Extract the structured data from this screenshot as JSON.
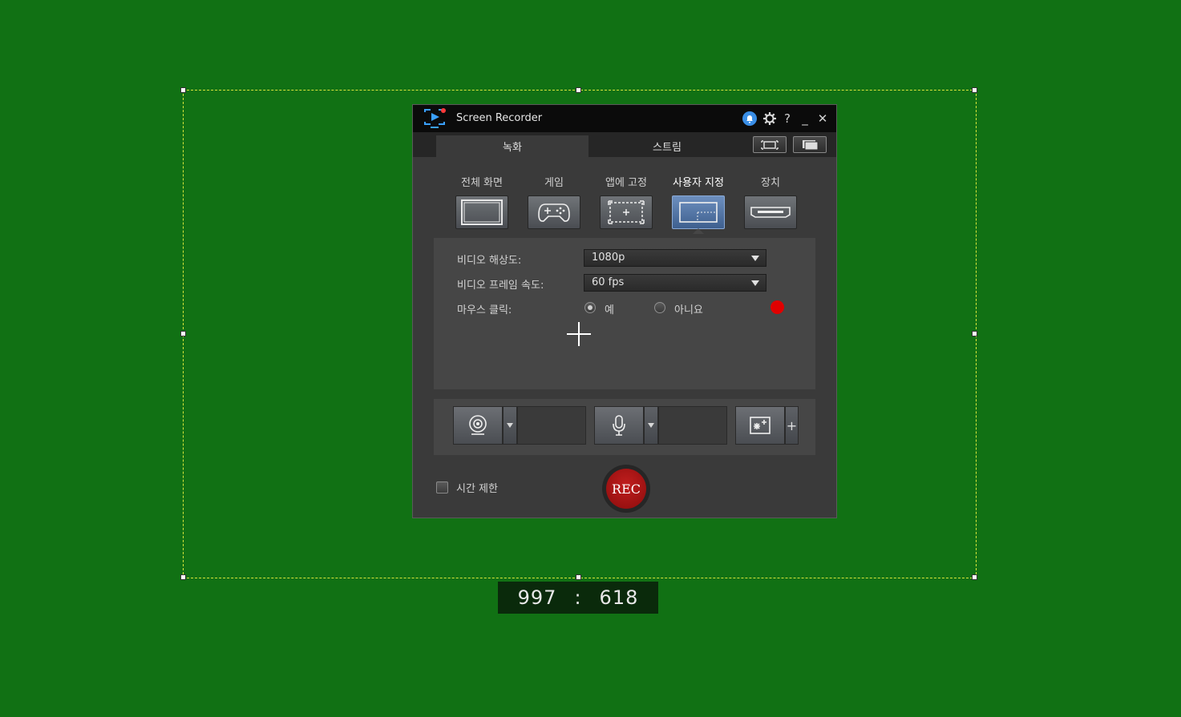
{
  "selection": {
    "width_readout": "997",
    "separator": ":",
    "height_readout": "618",
    "border_color": "#d8e63a"
  },
  "window": {
    "title": "Screen Recorder",
    "titlebar_buttons": [
      "notification-icon",
      "settings-icon",
      "help-icon",
      "minimize-icon",
      "close-icon"
    ],
    "help_glyph": "?",
    "minimize_glyph": "_",
    "close_glyph": "✕"
  },
  "tabs": [
    {
      "label": "녹화",
      "active": true
    },
    {
      "label": "스트림",
      "active": false
    }
  ],
  "modes": [
    {
      "label": "전체 화면",
      "icon": "fullscreen-icon",
      "active": false
    },
    {
      "label": "게임",
      "icon": "gamepad-icon",
      "active": false
    },
    {
      "label": "앱에 고정",
      "icon": "lock-to-app-icon",
      "active": false
    },
    {
      "label": "사용자 지정",
      "icon": "custom-area-icon",
      "active": true
    },
    {
      "label": "장치",
      "icon": "device-icon",
      "active": false
    }
  ],
  "settings": {
    "resolution_label": "비디오 해상도:",
    "resolution_value": "1080p",
    "framerate_label": "비디오 프레임 속도:",
    "framerate_value": "60 fps",
    "mouse_label": "마우스 클릭:",
    "mouse_yes": "예",
    "mouse_no": "아니요",
    "mouse_selected": "예",
    "click_color": "#e00000"
  },
  "devices": {
    "webcam_icon": "webcam-icon",
    "mic_icon": "microphone-icon",
    "effects_icon": "effects-icon",
    "add_glyph": "+"
  },
  "footer": {
    "time_limit_label": "시간 제한",
    "time_limit_checked": false,
    "rec_label": "REC"
  },
  "colors": {
    "background": "#117114",
    "accent_blue": "#3a8ee6",
    "active_mode": "#4f72a4",
    "rec_red": "#a81414"
  }
}
